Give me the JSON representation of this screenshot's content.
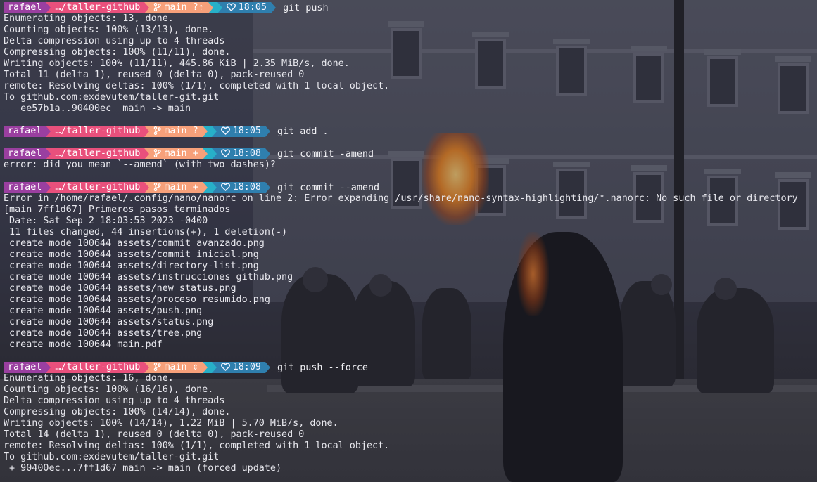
{
  "theme": {
    "user_bg": "#9a3fa0",
    "path_bg": "#e9507c",
    "git_bg": "#f7a07a",
    "time_bg": "#2f7fae",
    "accent_cyan": "#27b0c8"
  },
  "prompts": [
    {
      "user": "rafael",
      "path": "…/taller-github",
      "branch": "main",
      "status": "?⇡",
      "time": "18:05",
      "command": "git push",
      "branch_icon": "git-branch-icon",
      "time_icon": "heart-icon"
    },
    {
      "user": "rafael",
      "path": "…/taller-github",
      "branch": "main",
      "status": "?",
      "time": "18:05",
      "command": "git add .",
      "branch_icon": "git-branch-icon",
      "time_icon": "heart-icon"
    },
    {
      "user": "rafael",
      "path": "…/taller-github",
      "branch": "main",
      "status": "+",
      "time": "18:08",
      "command": "git commit -amend",
      "branch_icon": "git-branch-icon",
      "time_icon": "heart-icon"
    },
    {
      "user": "rafael",
      "path": "…/taller-github",
      "branch": "main",
      "status": "+",
      "time": "18:08",
      "command": "git commit --amend",
      "branch_icon": "git-branch-icon",
      "time_icon": "heart-icon"
    },
    {
      "user": "rafael",
      "path": "…/taller-github",
      "branch": "main",
      "status": "⇕",
      "time": "18:09",
      "command": "git push --force",
      "branch_icon": "git-branch-icon",
      "time_icon": "heart-icon"
    }
  ],
  "output": {
    "push1": [
      "Enumerating objects: 13, done.",
      "Counting objects: 100% (13/13), done.",
      "Delta compression using up to 4 threads",
      "Compressing objects: 100% (11/11), done.",
      "Writing objects: 100% (11/11), 445.86 KiB | 2.35 MiB/s, done.",
      "Total 11 (delta 1), reused 0 (delta 0), pack-reused 0",
      "remote: Resolving deltas: 100% (1/1), completed with 1 local object.",
      "To github.com:exdevutem/taller-git.git",
      "   ee57b1a..90400ec  main -> main"
    ],
    "commit_error": [
      "error: did you mean `--amend` (with two dashes)?"
    ],
    "amend": [
      "Error in /home/rafael/.config/nano/nanorc on line 2: Error expanding /usr/share/nano-syntax-highlighting/*.nanorc: No such file or directory",
      "[main 7ff1d67] Primeros pasos terminados",
      " Date: Sat Sep 2 18:03:53 2023 -0400",
      " 11 files changed, 44 insertions(+), 1 deletion(-)",
      " create mode 100644 assets/commit avanzado.png",
      " create mode 100644 assets/commit inicial.png",
      " create mode 100644 assets/directory-list.png",
      " create mode 100644 assets/instrucciones github.png",
      " create mode 100644 assets/new status.png",
      " create mode 100644 assets/proceso resumido.png",
      " create mode 100644 assets/push.png",
      " create mode 100644 assets/status.png",
      " create mode 100644 assets/tree.png",
      " create mode 100644 main.pdf"
    ],
    "push2": [
      "Enumerating objects: 16, done.",
      "Counting objects: 100% (16/16), done.",
      "Delta compression using up to 4 threads",
      "Compressing objects: 100% (14/14), done.",
      "Writing objects: 100% (14/14), 1.22 MiB | 5.70 MiB/s, done.",
      "Total 14 (delta 1), reused 0 (delta 0), pack-reused 0",
      "remote: Resolving deltas: 100% (1/1), completed with 1 local object.",
      "To github.com:exdevutem/taller-git.git",
      " + 90400ec...7ff1d67 main -> main (forced update)"
    ]
  }
}
